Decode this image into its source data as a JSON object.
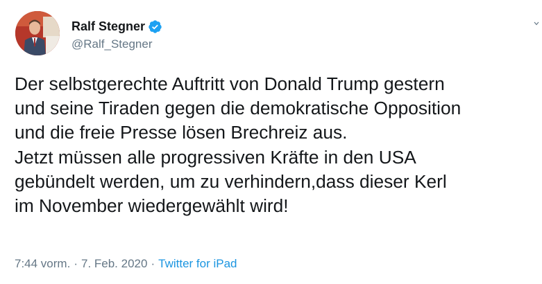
{
  "author": {
    "display_name": "Ralf Stegner",
    "handle": "@Ralf_Stegner",
    "verified": true
  },
  "tweet": {
    "lines": [
      "Der selbstgerechte Auftritt von Donald Trump gestern",
      "und seine Tiraden gegen die demokratische Opposition",
      "und die freie Presse lösen Brechreiz aus.",
      "Jetzt müssen alle progressiven Kräfte in den USA",
      "gebündelt werden, um zu verhindern,dass dieser Kerl",
      "im November wiedergewählt wird!"
    ]
  },
  "meta": {
    "time": "7:44 vorm.",
    "separator": "·",
    "date": "7. Feb. 2020",
    "source": "Twitter for iPad"
  },
  "icons": {
    "verified": "verified-badge-icon",
    "more": "chevron-down-icon"
  },
  "colors": {
    "text": "#14171a",
    "secondary": "#657786",
    "link": "#1b95e0",
    "verified": "#1da1f2"
  }
}
